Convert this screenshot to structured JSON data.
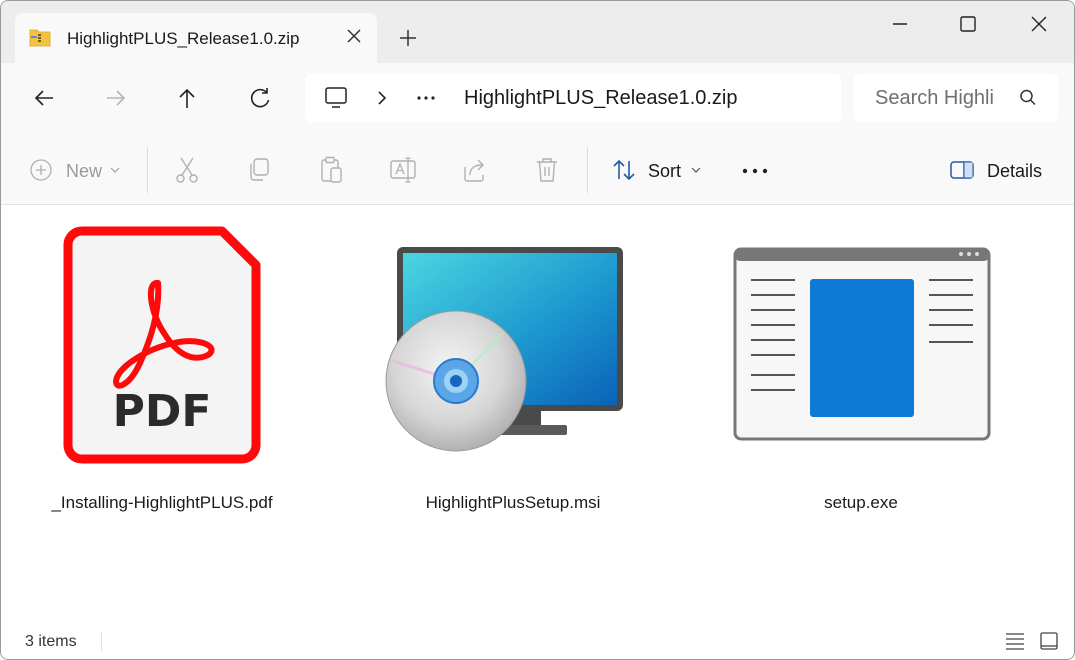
{
  "tab": {
    "title": "HighlightPLUS_Release1.0.zip",
    "icon": "zip-folder-icon"
  },
  "address": {
    "path": "HighlightPLUS_Release1.0.zip"
  },
  "search": {
    "placeholder": "Search Highlight"
  },
  "toolbar": {
    "new_label": "New",
    "sort_label": "Sort",
    "details_label": "Details"
  },
  "files": [
    {
      "name": "_Installing-HighlightPLUS.pdf",
      "type": "pdf-icon",
      "badge": "PDF"
    },
    {
      "name": "HighlightPlusSetup.msi",
      "type": "msi-installer-icon"
    },
    {
      "name": "setup.exe",
      "type": "application-window-icon"
    }
  ],
  "status": {
    "count": "3 items"
  },
  "colors": {
    "pdf_red": "#ff0a0a",
    "accent_blue": "#0a6fd0",
    "titlebar": "#ededed",
    "toolbar": "#f9f9f9"
  }
}
